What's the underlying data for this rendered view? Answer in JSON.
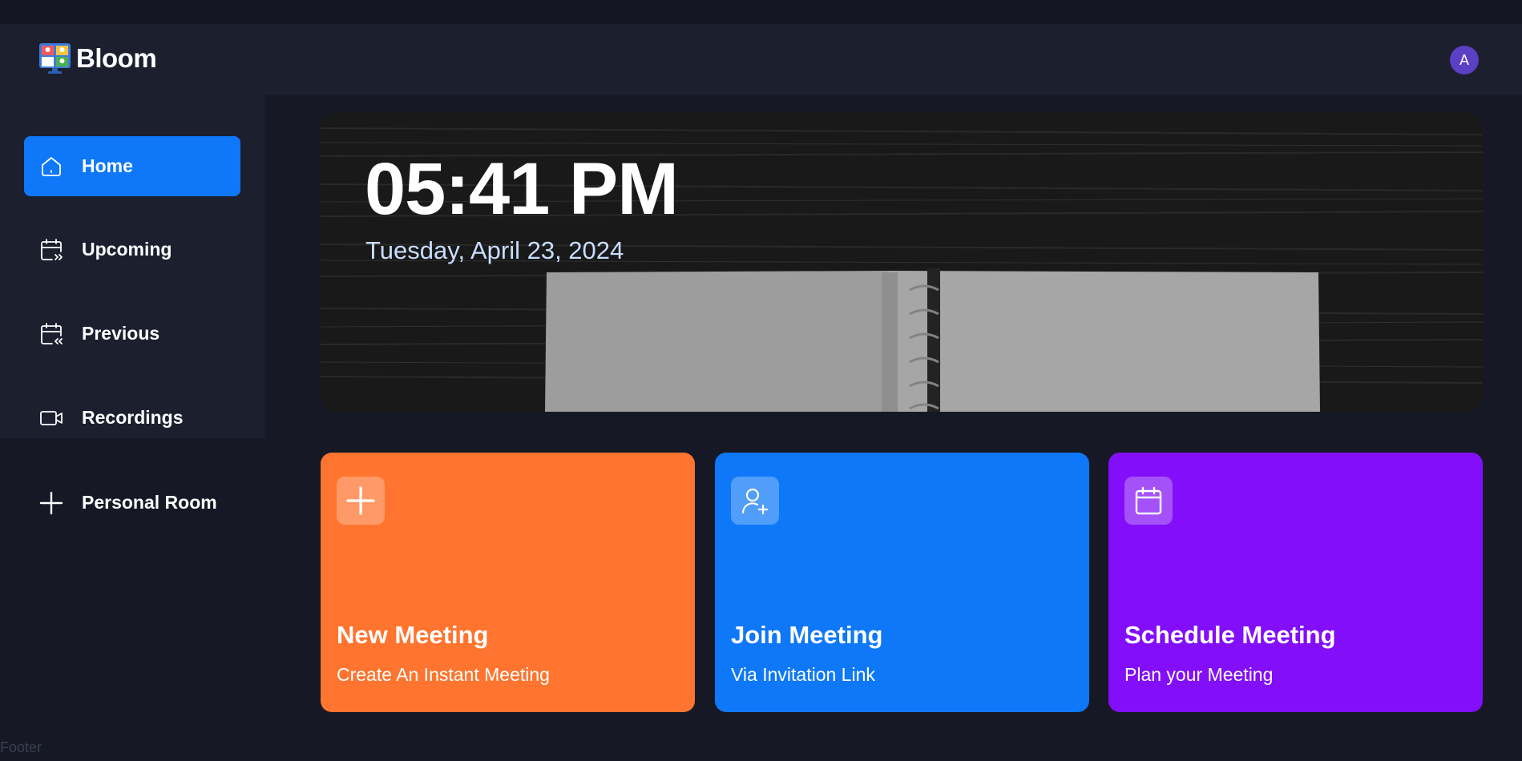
{
  "app": {
    "name": "Bloom",
    "avatar_letter": "A"
  },
  "sidebar": {
    "items": [
      {
        "label": "Home",
        "icon": "home-icon",
        "active": true
      },
      {
        "label": "Upcoming",
        "icon": "calendar-forward-icon",
        "active": false
      },
      {
        "label": "Previous",
        "icon": "calendar-back-icon",
        "active": false
      },
      {
        "label": "Recordings",
        "icon": "video-icon",
        "active": false
      },
      {
        "label": "Personal Room",
        "icon": "plus-icon",
        "active": false
      }
    ]
  },
  "hero": {
    "time": "05:41 PM",
    "date": "Tuesday, April 23, 2024"
  },
  "cards": [
    {
      "title": "New Meeting",
      "subtitle": "Create An Instant Meeting",
      "icon": "plus-icon",
      "color": "#ff742e"
    },
    {
      "title": "Join Meeting",
      "subtitle": "Via Invitation Link",
      "icon": "user-plus-icon",
      "color": "#0e78f9"
    },
    {
      "title": "Schedule Meeting",
      "subtitle": "Plan your Meeting",
      "icon": "calendar-icon",
      "color": "#830ef9"
    }
  ],
  "footer": {
    "text": "Footer"
  },
  "colors": {
    "background": "#161925",
    "panel": "#1c1f2e",
    "accent": "#0e78f9"
  }
}
